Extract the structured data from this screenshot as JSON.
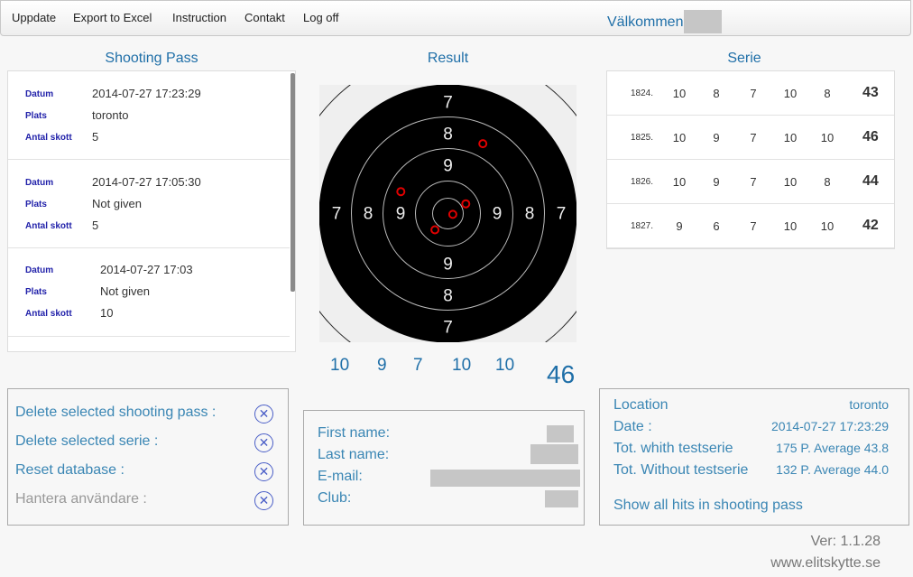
{
  "menu": {
    "items": [
      "Uppdate",
      "Export to Excel",
      "Instruction",
      "Contakt",
      "Log off"
    ],
    "welcome": "Välkommen"
  },
  "sections": {
    "shooting_pass": "Shooting Pass",
    "result": "Result",
    "serie": "Serie"
  },
  "shooting_passes": [
    {
      "datum_label": "Datum",
      "datum": "2014-07-27 17:23:29",
      "plats_label": "Plats",
      "plats": "toronto",
      "antal_label": "Antal skott",
      "antal": "5"
    },
    {
      "datum_label": "Datum",
      "datum": "2014-07-27 17:05:30",
      "plats_label": "Plats",
      "plats": "Not given",
      "antal_label": "Antal skott",
      "antal": "5"
    },
    {
      "datum_label": "Datum",
      "datum": "2014-07-27 17:03",
      "plats_label": "Plats",
      "plats": "Not given",
      "antal_label": "Antal skott",
      "antal": "10"
    }
  ],
  "target": {
    "ring_labels": [
      "7",
      "8",
      "9"
    ],
    "hits": [
      {
        "x": 2.15,
        "y": 4.3
      },
      {
        "x": -2.9,
        "y": 1.35
      },
      {
        "x": 1.1,
        "y": 0.6
      },
      {
        "x": 0.3,
        "y": -0.05
      },
      {
        "x": -0.8,
        "y": -1.0
      }
    ]
  },
  "result": {
    "shots": [
      "10",
      "9",
      "7",
      "10",
      "10"
    ],
    "total": "46"
  },
  "series": [
    {
      "id": "1824.",
      "values": [
        "10",
        "8",
        "7",
        "10",
        "8"
      ],
      "sum": "43"
    },
    {
      "id": "1825.",
      "values": [
        "10",
        "9",
        "7",
        "10",
        "10"
      ],
      "sum": "46"
    },
    {
      "id": "1826.",
      "values": [
        "10",
        "9",
        "7",
        "10",
        "8"
      ],
      "sum": "44"
    },
    {
      "id": "1827.",
      "values": [
        "9",
        "6",
        "7",
        "10",
        "10"
      ],
      "sum": "42"
    }
  ],
  "actions": {
    "delete_pass": "Delete selected shooting pass :",
    "delete_serie": "Delete selected serie :",
    "reset_db": "Reset database :",
    "manage_users": "Hantera användare :"
  },
  "user_info": {
    "first_name_label": "First name:",
    "last_name_label": "Last name:",
    "email_label": "E-mail:",
    "club_label": "Club:"
  },
  "pass_summary": {
    "location_label": "Location",
    "location": "toronto",
    "date_label": "Date :",
    "date": "2014-07-27 17:23:29",
    "tot_with_label": "Tot. whith testserie",
    "tot_with": "175 P. Average 43.8",
    "tot_without_label": "Tot. Without testserie",
    "tot_without": "132 P. Average 44.0",
    "show_all": "Show all hits in shooting pass"
  },
  "footer": {
    "version": "Ver: 1.1.28",
    "website": "www.elitskytte.se"
  },
  "colors": {
    "accent": "#1f6fa8",
    "link": "#3a86b4",
    "hit": "#e00000"
  }
}
